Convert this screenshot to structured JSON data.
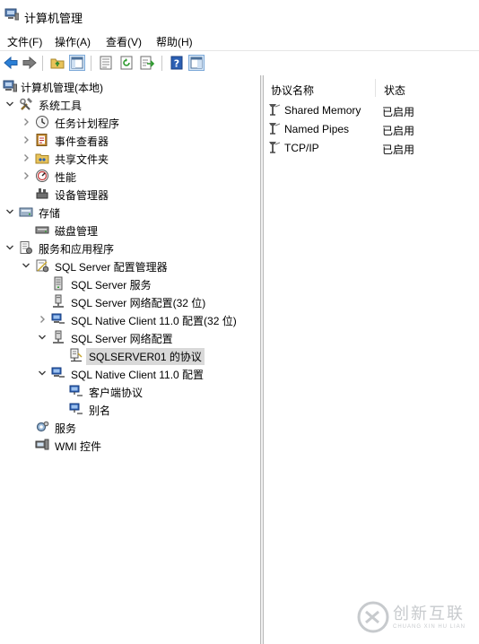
{
  "window": {
    "title": "计算机管理"
  },
  "menu": [
    "文件(F)",
    "操作(A)",
    "查看(V)",
    "帮助(H)"
  ],
  "toolbar": [
    "back-arrow-icon",
    "forward-arrow-icon",
    "up-folder-icon",
    "show-hide-tree-icon",
    "properties-icon",
    "refresh-icon",
    "export-list-icon",
    "help-icon",
    "console-tree-icon"
  ],
  "tree": [
    {
      "label": "计算机管理(本地)",
      "depth": 0,
      "expander": "none",
      "icon": "computer-management-icon"
    },
    {
      "label": "系统工具",
      "depth": 1,
      "expander": "expanded",
      "icon": "system-tools-icon"
    },
    {
      "label": "任务计划程序",
      "depth": 2,
      "expander": "collapsed",
      "icon": "task-scheduler-icon"
    },
    {
      "label": "事件查看器",
      "depth": 2,
      "expander": "collapsed",
      "icon": "event-viewer-icon"
    },
    {
      "label": "共享文件夹",
      "depth": 2,
      "expander": "collapsed",
      "icon": "shared-folders-icon"
    },
    {
      "label": "性能",
      "depth": 2,
      "expander": "collapsed",
      "icon": "performance-icon"
    },
    {
      "label": "设备管理器",
      "depth": 2,
      "expander": "none",
      "icon": "device-manager-icon"
    },
    {
      "label": "存储",
      "depth": 1,
      "expander": "expanded",
      "icon": "storage-icon"
    },
    {
      "label": "磁盘管理",
      "depth": 2,
      "expander": "none",
      "icon": "disk-management-icon"
    },
    {
      "label": "服务和应用程序",
      "depth": 1,
      "expander": "expanded",
      "icon": "services-applications-icon"
    },
    {
      "label": "SQL Server 配置管理器",
      "depth": 2,
      "expander": "expanded",
      "icon": "sql-config-manager-icon"
    },
    {
      "label": "SQL Server 服务",
      "depth": 3,
      "expander": "none",
      "icon": "sql-services-icon"
    },
    {
      "label": "SQL Server 网络配置(32 位)",
      "depth": 3,
      "expander": "none",
      "icon": "network-config-icon"
    },
    {
      "label": "SQL Native Client 11.0 配置(32 位)",
      "depth": 3,
      "expander": "collapsed",
      "icon": "native-client-icon"
    },
    {
      "label": "SQL Server 网络配置",
      "depth": 3,
      "expander": "expanded",
      "icon": "network-config-icon"
    },
    {
      "label": "SQLSERVER01 的协议",
      "depth": 4,
      "expander": "none",
      "icon": "protocols-icon",
      "selected": true
    },
    {
      "label": "SQL Native Client 11.0 配置",
      "depth": 3,
      "expander": "expanded",
      "icon": "native-client-icon"
    },
    {
      "label": "客户端协议",
      "depth": 4,
      "expander": "none",
      "icon": "client-protocols-icon"
    },
    {
      "label": "别名",
      "depth": 4,
      "expander": "none",
      "icon": "aliases-icon"
    },
    {
      "label": "服务",
      "depth": 2,
      "expander": "none",
      "icon": "services-gear-icon"
    },
    {
      "label": "WMI 控件",
      "depth": 2,
      "expander": "none",
      "icon": "wmi-control-icon"
    }
  ],
  "list": {
    "columns": [
      "协议名称",
      "状态"
    ],
    "rows": [
      {
        "name": "Shared Memory",
        "state": "已启用"
      },
      {
        "name": "Named Pipes",
        "state": "已启用"
      },
      {
        "name": "TCP/IP",
        "state": "已启用"
      }
    ]
  },
  "watermark": {
    "brand": "创新互联",
    "sub": "CHUANG XIN HU LIAN"
  },
  "colors": {
    "selection": "#d9d9d9",
    "accent": "#1e6fd0",
    "splitter": "#b9b9b9"
  }
}
